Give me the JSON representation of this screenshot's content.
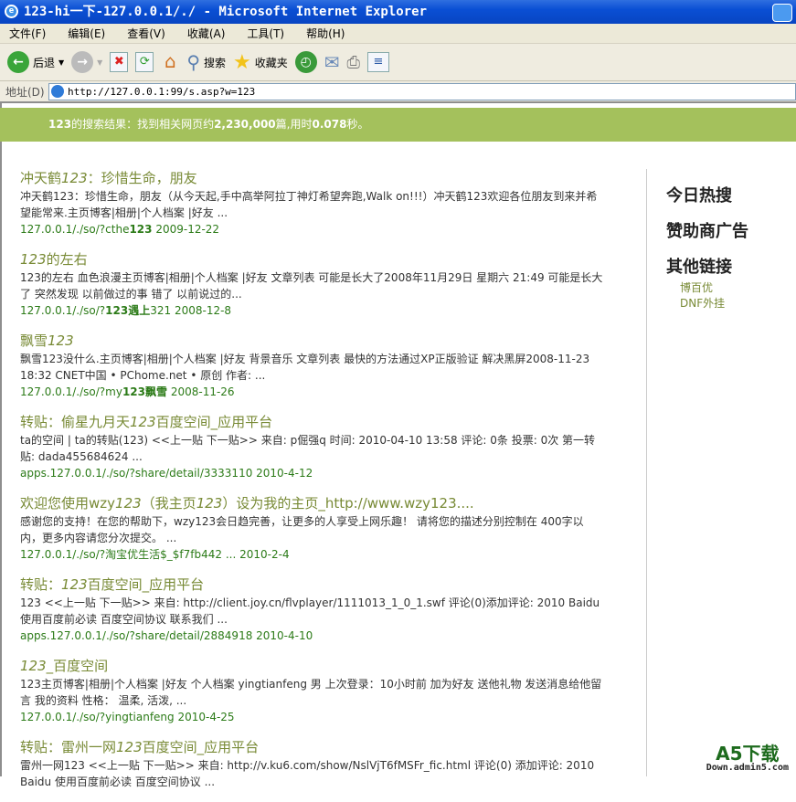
{
  "window": {
    "title": "123-hi一下-127.0.0.1/./ - Microsoft Internet Explorer"
  },
  "menu": [
    "文件(F)",
    "编辑(E)",
    "查看(V)",
    "收藏(A)",
    "工具(T)",
    "帮助(H)"
  ],
  "toolbar": {
    "back": "后退",
    "search": "搜索",
    "favorites": "收藏夹"
  },
  "address": {
    "label": "地址(D)",
    "url": "http://127.0.0.1:99/s.asp?w=123"
  },
  "banner": {
    "query": "123",
    "t1": "的搜索结果：找到相关网页约",
    "count": "2,230,000",
    "t2": "篇,用时",
    "time": "0.078",
    "t3": "秒。"
  },
  "results": [
    {
      "title": [
        {
          "t": "冲天鹤"
        },
        {
          "t": "123",
          "i": true
        },
        {
          "t": "：珍惜生命，朋友"
        }
      ],
      "desc": "冲天鹤123：珍惜生命，朋友（从今天起,手中高举阿拉丁神灯希望奔跑,Walk on!!!）冲天鹤123欢迎各位朋友到来并希望能常来.主页博客|相册|个人档案 |好友 ...",
      "url": [
        {
          "t": "127.0.0.1/./so/?cthe"
        },
        {
          "t": "123",
          "b": true
        },
        {
          "t": " 2009-12-22"
        }
      ]
    },
    {
      "title": [
        {
          "t": "123",
          "i": true
        },
        {
          "t": "的左右"
        }
      ],
      "desc": "123的左右 血色浪漫主页博客|相册|个人档案 |好友 文章列表 可能是长大了2008年11月29日 星期六 21:49 可能是长大了 突然发现 以前做过的事 错了 以前说过的...",
      "url": [
        {
          "t": "127.0.0.1/./so/?"
        },
        {
          "t": "123遇上",
          "b": true
        },
        {
          "t": "321 2008-12-8"
        }
      ]
    },
    {
      "title": [
        {
          "t": "飘雪"
        },
        {
          "t": "123",
          "i": true
        }
      ],
      "desc": "飘雪123没什么.主页博客|相册|个人档案 |好友 背景音乐 文章列表 最快的方法通过XP正版验证 解决黑屏2008-11-23 18:32 CNET中国 • PChome.net • 原创 作者: ...",
      "url": [
        {
          "t": "127.0.0.1/./so/?my"
        },
        {
          "t": "123飘雪",
          "b": true
        },
        {
          "t": "  2008-11-26"
        }
      ]
    },
    {
      "title": [
        {
          "t": "转贴：偷星九月天"
        },
        {
          "t": "123",
          "i": true
        },
        {
          "t": "百度空间_应用平台"
        }
      ],
      "desc": "ta的空间 | ta的转贴(123) <<上一贴 下一贴>> 来自: p倔强q 时间: 2010-04-10 13:58 评论: 0条 投票: 0次 第一转贴: dada455684624 ...",
      "url": [
        {
          "t": "apps.127.0.0.1/./so/?share/detail/3333110 2010-4-12"
        }
      ]
    },
    {
      "title": [
        {
          "t": "欢迎您使用wzy"
        },
        {
          "t": "123",
          "i": true
        },
        {
          "t": "（我主页"
        },
        {
          "t": "123",
          "i": true
        },
        {
          "t": "）设为我的主页_http://www.wzy123...."
        }
      ],
      "desc": "感谢您的支持！在您的帮助下，wzy123会日趋完善，让更多的人享受上网乐趣！ 请将您的描述分别控制在 400字以内，更多内容请您分次提交。 ...",
      "url": [
        {
          "t": "127.0.0.1/./so/?淘宝优生活$_$f7fb442 ... 2010-2-4"
        }
      ]
    },
    {
      "title": [
        {
          "t": "转贴："
        },
        {
          "t": "123",
          "i": true
        },
        {
          "t": "百度空间_应用平台"
        }
      ],
      "desc": "123 <<上一贴 下一贴>> 来自: http://client.joy.cn/flvplayer/1111013_1_0_1.swf 评论(0)添加评论: 2010 Baidu 使用百度前必读 百度空间协议 联系我们 ...",
      "url": [
        {
          "t": "apps.127.0.0.1/./so/?share/detail/2884918 2010-4-10"
        }
      ]
    },
    {
      "title": [
        {
          "t": "123",
          "i": true
        },
        {
          "t": "_百度空间"
        }
      ],
      "desc": "123主页博客|相册|个人档案 |好友 个人档案 yingtianfeng 男 上次登录：10小时前 加为好友 送他礼物 发送消息给他留言 我的资料 性格： 温柔, 活泼, ...",
      "url": [
        {
          "t": "127.0.0.1/./so/?yingtianfeng 2010-4-25"
        }
      ]
    },
    {
      "title": [
        {
          "t": "转贴：雷州一网"
        },
        {
          "t": "123",
          "i": true
        },
        {
          "t": "百度空间_应用平台"
        }
      ],
      "desc": "雷州一网123 <<上一贴 下一贴>> 来自: http://v.ku6.com/show/NslVjT6fMSFr_fic.html 评论(0) 添加评论: 2010 Baidu 使用百度前必读 百度空间协议 ...",
      "url": []
    }
  ],
  "sidebar": {
    "hot": "今日热搜",
    "ads": "赞助商广告",
    "other": "其他链接",
    "links": [
      "博百优",
      "DNF外挂"
    ]
  },
  "watermark": {
    "a": "A5下载",
    "b": "Down.admin5.com"
  }
}
